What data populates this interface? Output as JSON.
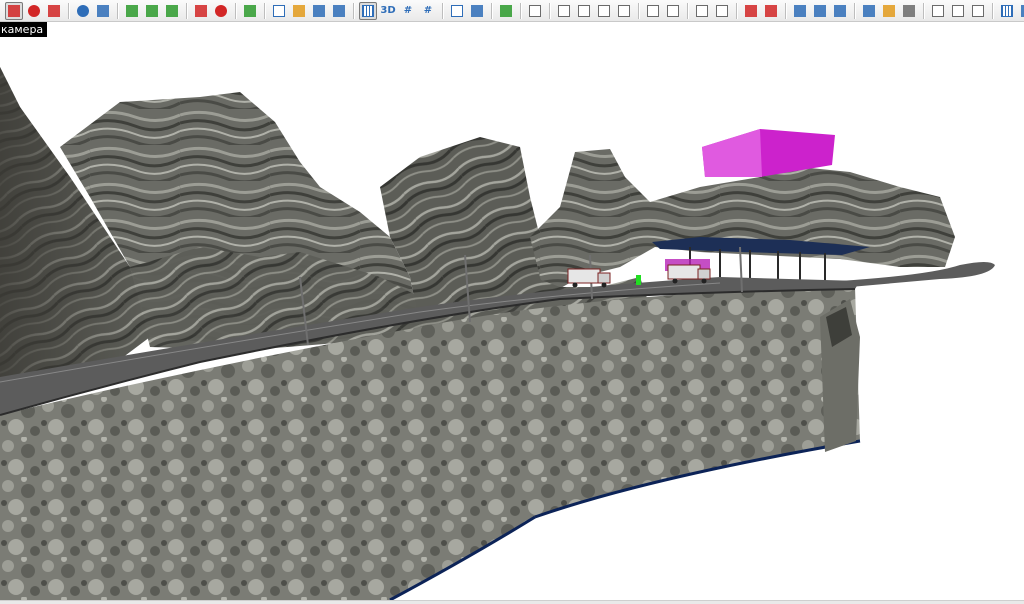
{
  "viewport": {
    "label": "камера"
  },
  "toolbar": {
    "groups": [
      [
        "new-scene-icon",
        "red-sphere-icon",
        "red-cylinder-icon"
      ],
      [
        "blue-sphere-icon",
        "blue-cube-icon"
      ],
      [
        "green-cube-icon",
        "green-box-icon",
        "green-pyramid-icon"
      ],
      [
        "red-box-icon",
        "smiley-icon"
      ],
      [
        "landscape-icon"
      ],
      [
        "new-document-icon",
        "open-folder-icon",
        "save-icon",
        "save-as-icon"
      ],
      [
        "grid-icon",
        "3d-view-icon",
        "snap-grid-icon",
        "snap-grid-plus-icon"
      ],
      [
        "copy-object-icon",
        "replace-object-icon"
      ],
      [
        "pin-icon"
      ],
      [
        "edit-icon"
      ],
      [
        "align-left-icon",
        "align-bottom-icon",
        "align-top-icon",
        "align-right-icon"
      ],
      [
        "arrow-up-icon",
        "arrow-left-icon"
      ],
      [
        "rotate-left-icon",
        "rotate-right-icon"
      ],
      [
        "add-point-icon",
        "add-node-icon"
      ],
      [
        "select-area-icon",
        "select-group-icon",
        "selection-icon"
      ],
      [
        "box-select-icon",
        "cube-frame-icon",
        "cube-solid-icon"
      ],
      [
        "cut-icon",
        "copy-icon",
        "paste-icon"
      ],
      [
        "hatch-icon",
        "bounds-icon"
      ],
      [
        "fit-view-icon",
        "camera-view-icon"
      ]
    ],
    "pressed": [
      "new-scene-icon",
      "grid-icon",
      "camera-view-icon"
    ],
    "labels": {
      "3d-view-icon": "3D",
      "snap-grid-icon": "#",
      "snap-grid-plus-icon": "#"
    }
  },
  "colors": {
    "accent_red": "#d22626",
    "accent_blue": "#2e6db8",
    "accent_green": "#2d9b2d",
    "accent_orange": "#e39b1c",
    "magenta_box": "#cc22cc",
    "rock_dark": "#4e4e48",
    "rock_light": "#8d8e86",
    "road": "#5c5c5c",
    "wall": "#7a7a73",
    "canopy": "#1d2f56",
    "marker": "#22dd22",
    "edge_dark": "#0c2357"
  }
}
